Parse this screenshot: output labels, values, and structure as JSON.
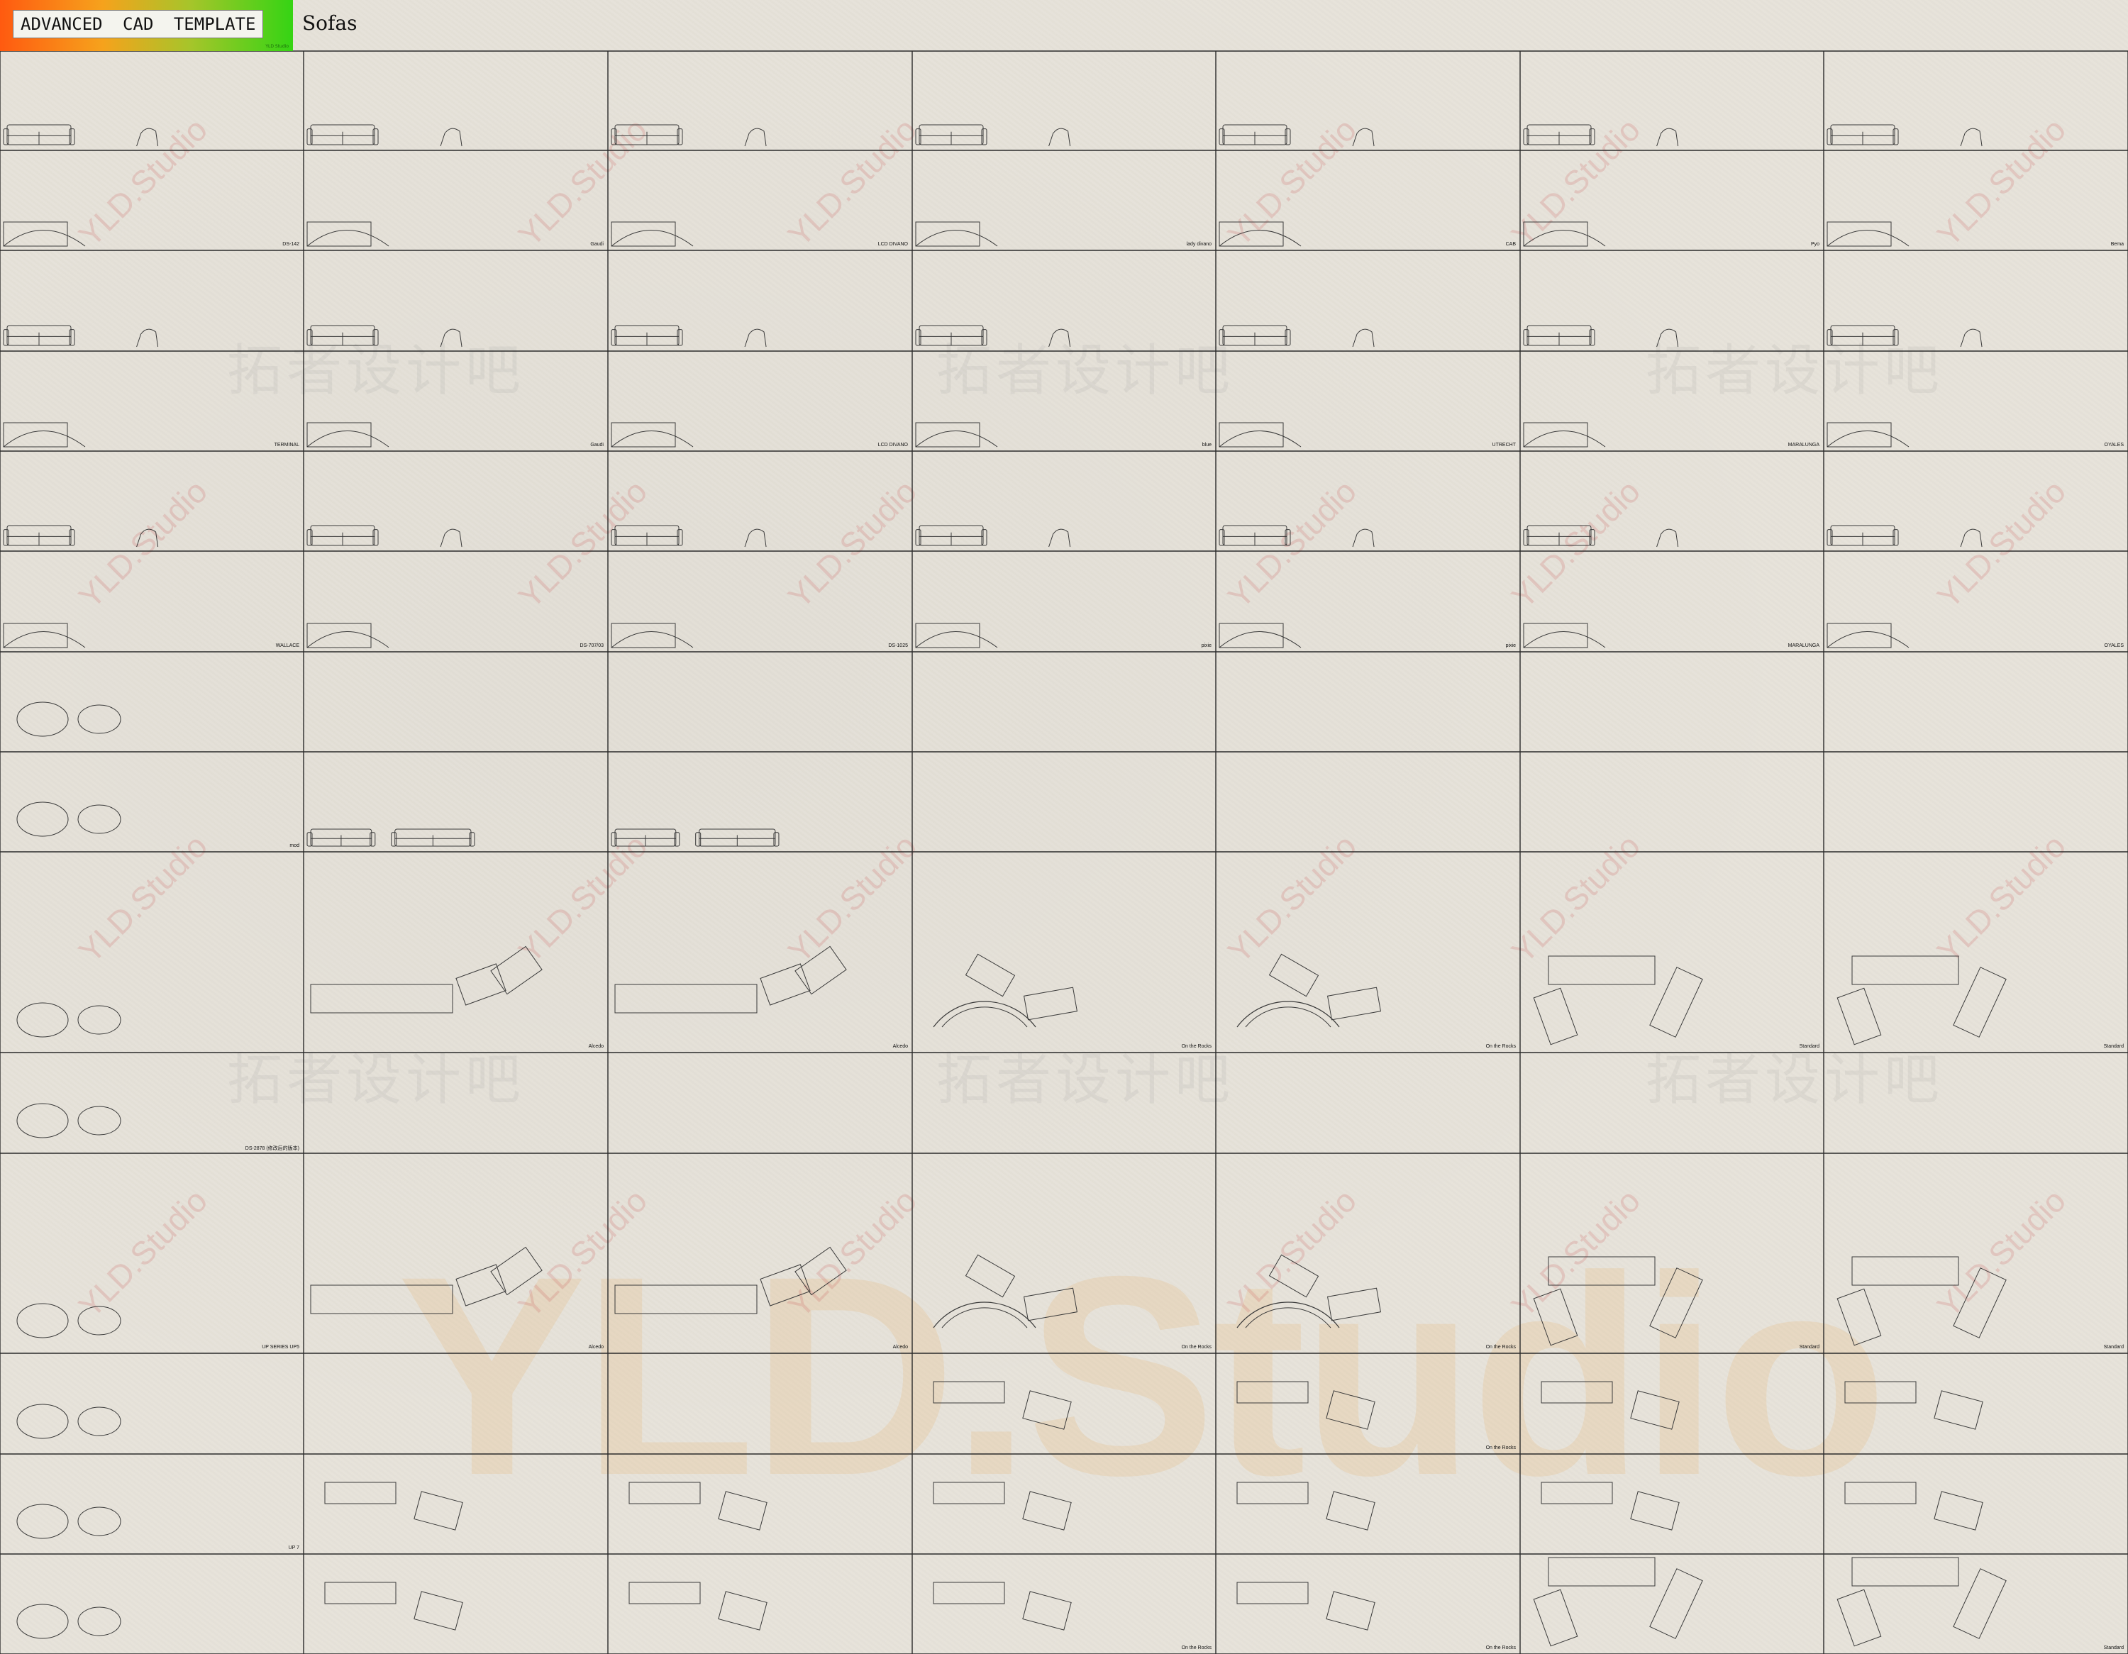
{
  "header": {
    "template_label": "ADVANCED CAD TEMPLATE",
    "template_sublabel": "YLD Studio",
    "sheet_title": "Sofas"
  },
  "watermark": {
    "studio": "YLD.Studio",
    "big": "YLD.Studio",
    "chinese": "拓者设计吧"
  },
  "cell_labels": [
    [
      "DS-142",
      "Gaudi",
      "LCD DIVANO",
      "lady divano",
      "CAB",
      "Pyo",
      "Bema"
    ],
    [
      "TERMINAL",
      "Gaudi",
      "LCD DIVANO",
      "blue",
      "UTRECHT",
      "MARALUNGA",
      "OYALES"
    ],
    [
      "WALLACE",
      "DS-707/03",
      "DS-1025",
      "pixie",
      "pixie",
      "MARALUNGA",
      "OYALES"
    ],
    [
      "mod",
      "",
      "",
      "",
      "",
      "",
      ""
    ],
    [
      "",
      "Alcedo",
      "Alcedo",
      "On the Rocks",
      "On the Rocks",
      "Standard",
      "Standard"
    ],
    [
      "DS-2878  (修改后的版本)",
      "",
      "",
      "",
      "",
      "",
      ""
    ],
    [
      "UP SERIES  UP5",
      "Alcedo",
      "Alcedo",
      "On the Rocks",
      "On the Rocks",
      "Standard",
      "Standard"
    ],
    [
      "",
      "",
      "",
      "",
      "On the Rocks",
      "",
      ""
    ],
    [
      "UP 7",
      "",
      "",
      "",
      "",
      "",
      ""
    ],
    [
      "",
      "",
      "",
      "On the Rocks",
      "On the Rocks",
      "",
      "Standard"
    ]
  ],
  "colors": {
    "background": "#e7e3da",
    "grid_line": "#2a2a2a",
    "drawing_line": "#3a3a3a",
    "badge_start": "#ff5a10",
    "badge_end": "#35d414"
  }
}
